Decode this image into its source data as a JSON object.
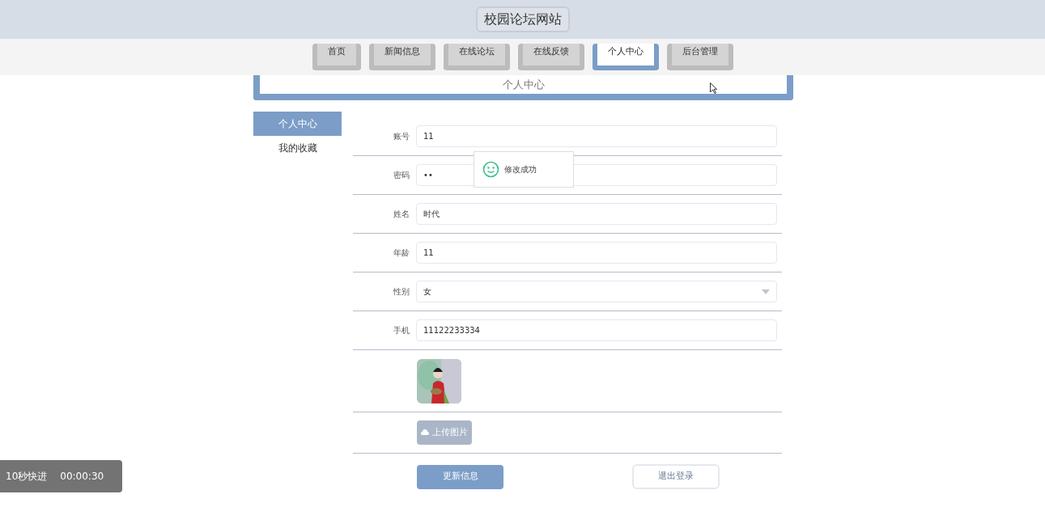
{
  "site_title": "校园论坛网站",
  "nav": [
    {
      "label": "首页",
      "selected": false
    },
    {
      "label": "新闻信息",
      "selected": false
    },
    {
      "label": "在线论坛",
      "selected": false
    },
    {
      "label": "在线反馈",
      "selected": false
    },
    {
      "label": "个人中心",
      "selected": true
    },
    {
      "label": "后台管理",
      "selected": false
    }
  ],
  "panel_title": "个人中心",
  "sidebar": [
    {
      "label": "个人中心",
      "selected": true
    },
    {
      "label": "我的收藏",
      "selected": false
    }
  ],
  "fields": [
    {
      "kind": "text",
      "label": "账号",
      "value": "11"
    },
    {
      "kind": "text",
      "label": "密码",
      "value": "••"
    },
    {
      "kind": "text",
      "label": "姓名",
      "value": "时代"
    },
    {
      "kind": "text",
      "label": "年龄",
      "value": "11"
    },
    {
      "kind": "select",
      "label": "性别",
      "value": "女"
    },
    {
      "kind": "text",
      "label": "手机",
      "value": "11122233334"
    }
  ],
  "upload_button": "上传图片",
  "update_button": "更新信息",
  "logout_button": "退出登录",
  "toast": "修改成功",
  "video_overlay": {
    "skip": "10秒快进",
    "time": "00:00:30"
  }
}
